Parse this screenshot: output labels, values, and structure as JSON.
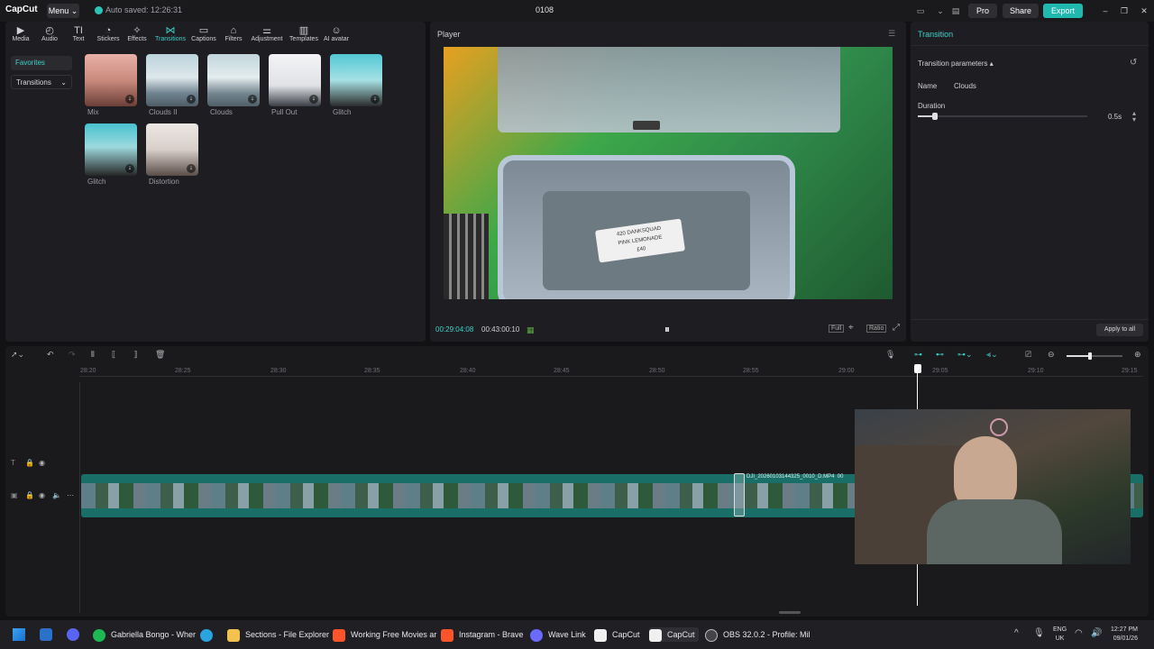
{
  "app": {
    "logo": "CapCut",
    "menu_label": "Menu",
    "autosave": "Auto saved: 12:26:31",
    "project_title": "0108",
    "pro_label": "Pro",
    "share_label": "Share",
    "export_label": "Export"
  },
  "toolbar": [
    {
      "label": "Media",
      "icon": "media-icon"
    },
    {
      "label": "Audio",
      "icon": "audio-icon"
    },
    {
      "label": "Text",
      "icon": "text-icon"
    },
    {
      "label": "Stickers",
      "icon": "stickers-icon"
    },
    {
      "label": "Effects",
      "icon": "effects-icon"
    },
    {
      "label": "Transitions",
      "icon": "transitions-icon",
      "active": true
    },
    {
      "label": "Captions",
      "icon": "captions-icon"
    },
    {
      "label": "Filters",
      "icon": "filters-icon"
    },
    {
      "label": "Adjustment",
      "icon": "adjustment-icon"
    },
    {
      "label": "Templates",
      "icon": "templates-icon"
    },
    {
      "label": "AI avatar",
      "icon": "ai-avatar-icon"
    }
  ],
  "sidebar": {
    "favorites": "Favorites",
    "transitions": "Transitions"
  },
  "transitions": [
    {
      "label": "Mix"
    },
    {
      "label": "Clouds II"
    },
    {
      "label": "Clouds"
    },
    {
      "label": "Pull Out"
    },
    {
      "label": "Glitch"
    },
    {
      "label": "Glitch"
    },
    {
      "label": "Distortion"
    }
  ],
  "player": {
    "title": "Player",
    "current_time": "00:29:04:08",
    "total_time": "00:43:00:10",
    "full_label": "Full",
    "ratio_label": "Ratio",
    "sticker_line1": "420 DANKSQUAD",
    "sticker_line2": "PINK LEMONADE",
    "sticker_line3": "£40"
  },
  "inspector": {
    "title": "Transition",
    "section": "Transition parameters",
    "name_label": "Name",
    "name_value": "Clouds",
    "duration_label": "Duration",
    "duration_value": "0.5s",
    "duration_fraction": 0.1,
    "apply_all": "Apply to all"
  },
  "timeline": {
    "ruler": [
      "28:20",
      "28:25",
      "28:30",
      "28:35",
      "28:40",
      "28:45",
      "28:50",
      "28:55",
      "29:00",
      "29:05",
      "29:10",
      "29:15"
    ],
    "clip_name": "DJI_20260103144325_0010_D.MP4",
    "clip_name_tail": "00"
  },
  "taskbar": [
    {
      "label": "Gabriella Bongo - Wher",
      "icon": "spotify-icon",
      "color": "#1db954"
    },
    {
      "label": "",
      "icon": "telegram-icon",
      "color": "#2aa3df"
    },
    {
      "label": "Sections - File Explorer",
      "icon": "folder-icon",
      "color": "#f2c14e"
    },
    {
      "label": "Working Free Movies ar",
      "icon": "brave-icon",
      "color": "#fb542b"
    },
    {
      "label": "Instagram - Brave",
      "icon": "brave-icon",
      "color": "#fb542b"
    },
    {
      "label": "Wave Link",
      "icon": "wave-link-icon",
      "color": "#8a8aff"
    },
    {
      "label": "CapCut",
      "icon": "capcut-icon",
      "color": "#ffffff"
    },
    {
      "label": "CapCut",
      "icon": "capcut-icon",
      "color": "#ffffff"
    },
    {
      "label": "OBS 32.0.2 - Profile: Mil",
      "icon": "obs-icon",
      "color": "#444448"
    }
  ],
  "tray": {
    "lang1": "ENG",
    "lang2": "UK",
    "time": "12:27 PM",
    "date": "09/01/26"
  }
}
